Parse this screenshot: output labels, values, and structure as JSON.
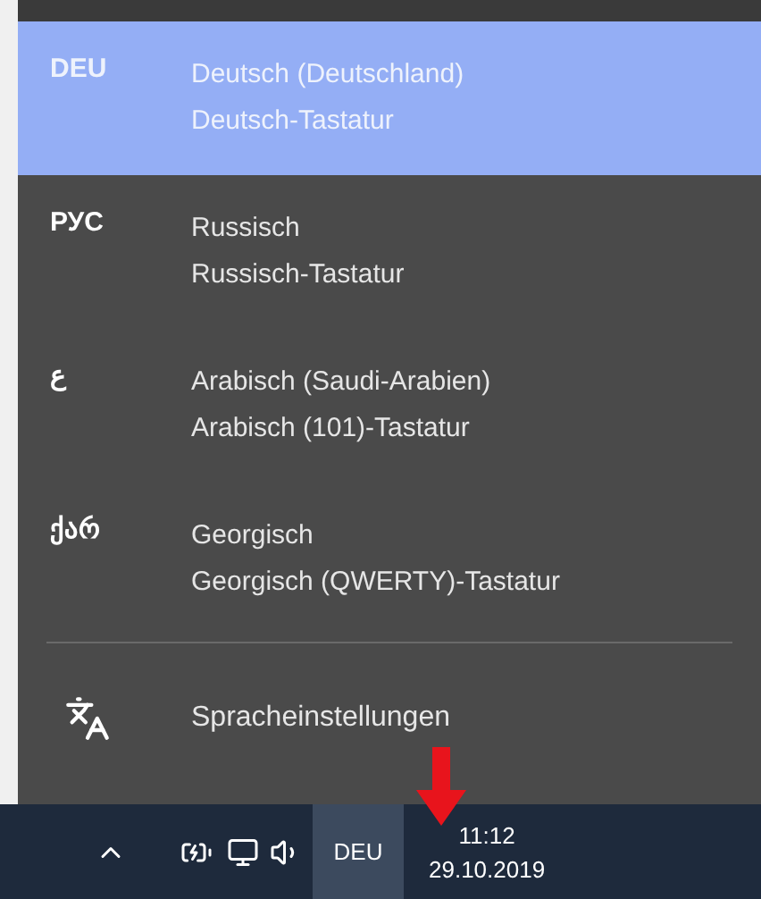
{
  "languages": [
    {
      "code": "DEU",
      "name": "Deutsch (Deutschland)",
      "keyboard": "Deutsch-Tastatur",
      "selected": true
    },
    {
      "code": "РУС",
      "name": "Russisch",
      "keyboard": "Russisch-Tastatur",
      "selected": false
    },
    {
      "code": "ع",
      "name": "Arabisch (Saudi-Arabien)",
      "keyboard": "Arabisch (101)-Tastatur",
      "selected": false
    },
    {
      "code": "ქარ",
      "name": "Georgisch",
      "keyboard": "Georgisch (QWERTY)-Tastatur",
      "selected": false
    }
  ],
  "settings_link": "Spracheinstellungen",
  "taskbar": {
    "language": "DEU",
    "time": "11:12",
    "date": "29.10.2019"
  }
}
